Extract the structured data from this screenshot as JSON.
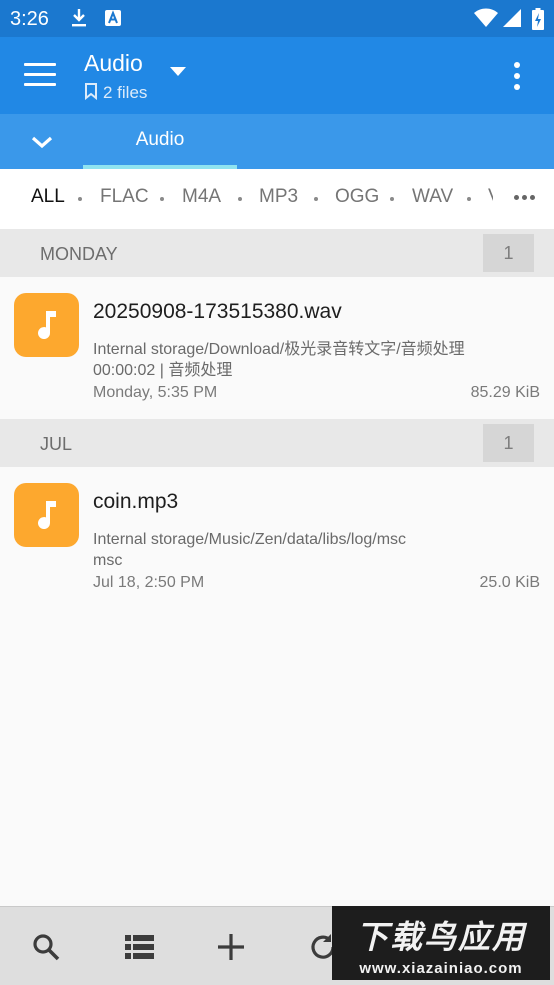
{
  "status_bar": {
    "time": "3:26",
    "icons": [
      "download-icon",
      "text-a-icon",
      "wifi-icon",
      "signal-icon",
      "battery-icon"
    ]
  },
  "app_bar": {
    "title": "Audio",
    "subtitle": "2 files",
    "icons": [
      "menu-icon",
      "dropdown-caret-icon",
      "bookmark-icon",
      "more-vert-icon"
    ]
  },
  "tabs": {
    "items": [
      {
        "label": "Audio",
        "active": true
      }
    ],
    "indicator_color": "#8fe3f0"
  },
  "filters": {
    "items": [
      "ALL",
      "FLAC",
      "M4A",
      "MP3",
      "OGG",
      "WAV",
      "V"
    ],
    "active": "ALL"
  },
  "sections": [
    {
      "label": "MONDAY",
      "count": "1",
      "files": [
        {
          "name": "20250908-173515380.wav",
          "path_line1": "Internal storage/Download/极光录音转文字/音频处理",
          "path_line2": "00:00:02  |  音频处理",
          "date": "Monday, 5:35 PM",
          "size": "85.29 KiB",
          "icon": "music-note-icon"
        }
      ]
    },
    {
      "label": "JUL",
      "count": "1",
      "files": [
        {
          "name": "coin.mp3",
          "path_line1": "Internal storage/Music/Zen/data/libs/log/msc",
          "path_line2": "msc",
          "date": "Jul 18, 2:50 PM",
          "size": "25.0 KiB",
          "icon": "music-note-icon"
        }
      ]
    }
  ],
  "bottom_bar": {
    "icons": [
      "search-icon",
      "list-view-icon",
      "add-icon",
      "refresh-icon"
    ]
  },
  "watermark": {
    "title": "下载鸟应用",
    "url": "www.xiazainiao.com"
  },
  "colors": {
    "status_bar": "#1b78cf",
    "app_bar": "#2188e5",
    "tab_bar": "#3a98ea",
    "file_icon": "#fda82e"
  }
}
